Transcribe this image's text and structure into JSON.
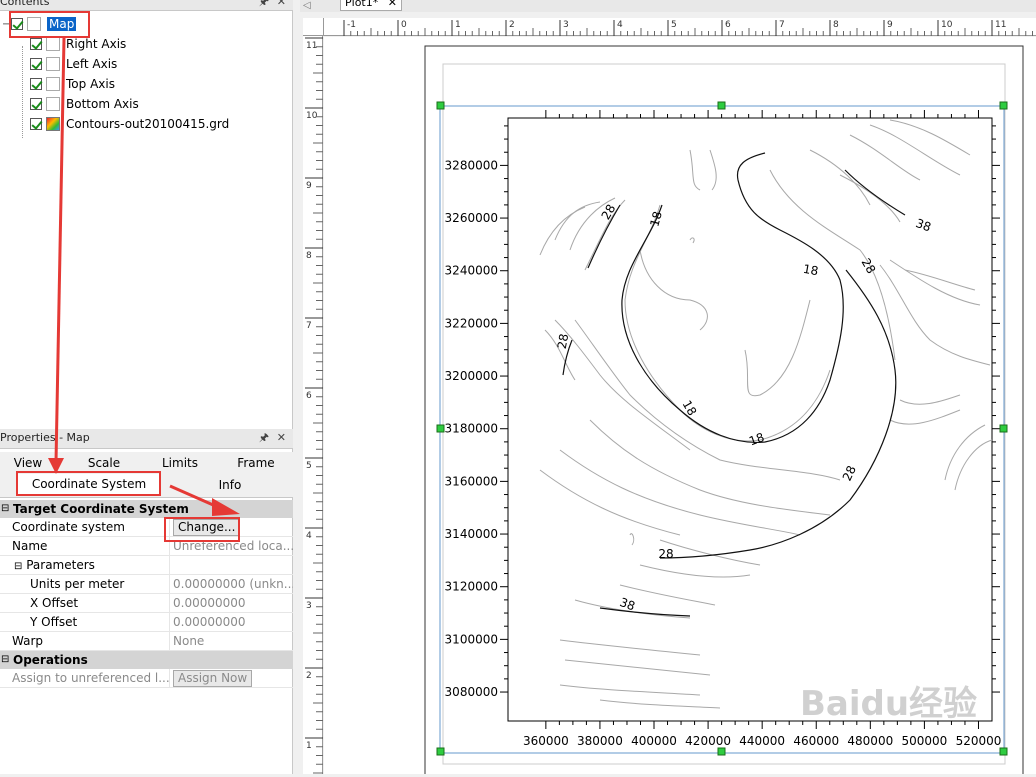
{
  "contents": {
    "title": "Contents",
    "tree": [
      {
        "label": "Map",
        "checked": true,
        "selected": true
      },
      {
        "label": "Right Axis",
        "checked": true
      },
      {
        "label": "Left Axis",
        "checked": true
      },
      {
        "label": "Top Axis",
        "checked": true
      },
      {
        "label": "Bottom Axis",
        "checked": true
      },
      {
        "label": "Contours-out20100415.grd",
        "checked": true
      }
    ]
  },
  "properties": {
    "title": "Properties - Map",
    "tabs": [
      "View",
      "Scale",
      "Limits",
      "Frame",
      "Coordinate System",
      "Info"
    ],
    "active_tab": "Coordinate System",
    "sections": {
      "target": {
        "title": "Target Coordinate System",
        "coordinate_system_label": "Coordinate system",
        "change_button": "Change...",
        "name_label": "Name",
        "name_value": "Unreferenced loca...",
        "parameters_label": "Parameters",
        "units_label": "Units per meter",
        "units_value": "0.00000000 (unkn...",
        "xoffset_label": "X Offset",
        "xoffset_value": "0.00000000",
        "yoffset_label": "Y Offset",
        "yoffset_value": "0.00000000",
        "warp_label": "Warp",
        "warp_value": "None"
      },
      "operations": {
        "title": "Operations",
        "assign_field": "Assign to unreferenced l...",
        "assign_button": "Assign Now"
      }
    }
  },
  "document": {
    "tab_label": "Plot1*",
    "hruler_labels": [
      "-1",
      "0",
      "1",
      "2",
      "3",
      "4",
      "5",
      "6",
      "7",
      "8",
      "9",
      "10",
      "11"
    ],
    "vruler_labels": [
      "11",
      "10",
      "9",
      "8",
      "7",
      "6",
      "5",
      "4",
      "3",
      "2",
      "1"
    ]
  },
  "chart_data": {
    "type": "contour",
    "x_ticks": [
      "360000",
      "380000",
      "400000",
      "420000",
      "440000",
      "460000",
      "480000",
      "500000",
      "520000"
    ],
    "y_ticks": [
      "3280000",
      "3260000",
      "3240000",
      "3220000",
      "3200000",
      "3180000",
      "3160000",
      "3140000",
      "3120000",
      "3100000",
      "3080000"
    ],
    "xlim": [
      346000,
      525000
    ],
    "ylim": [
      3069000,
      3298000
    ],
    "contour_labels": [
      "28",
      "18",
      "38",
      "18",
      "28",
      "28",
      "18",
      "18",
      "28",
      "28",
      "38"
    ]
  },
  "watermark": "Baidu经验"
}
